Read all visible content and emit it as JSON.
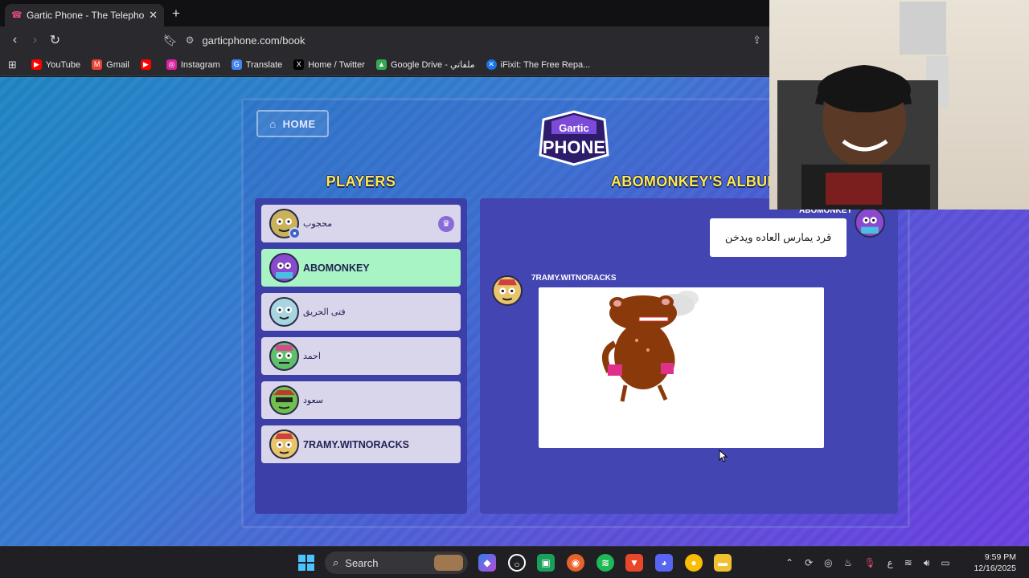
{
  "browser": {
    "tab_title": "Gartic Phone - The Telephone Ga",
    "tab_favicon": "phone-icon",
    "url": "garticphone.com/book",
    "bookmarks": [
      {
        "label": "YouTube",
        "color": "#ff0000"
      },
      {
        "label": "Gmail",
        "color": "#ea4335"
      },
      {
        "label": "",
        "color": "#ff0000"
      },
      {
        "label": "Instagram",
        "color": "#d6249f"
      },
      {
        "label": "Translate",
        "color": "#4285f4"
      },
      {
        "label": "Home / Twitter",
        "color": "#000000"
      },
      {
        "label": "Google Drive - ملفاتي",
        "color": "#34a853"
      },
      {
        "label": "iFixit: The Free Repa...",
        "color": "#1a73e8"
      }
    ]
  },
  "game": {
    "home_label": "HOME",
    "logo_top": "Gartic",
    "logo_bottom": "PHONE",
    "players_title": "PLAYERS",
    "album_title": "ABOMONKEY'S ALBUM",
    "players": [
      {
        "name": "محجوب",
        "active": false,
        "host": true,
        "color": "#c9b25a"
      },
      {
        "name": "ABOMONKEY",
        "active": true,
        "host": false,
        "color": "#8a4ad0"
      },
      {
        "name": "فتى الحريق",
        "active": false,
        "host": false,
        "color": "#a8d6e0"
      },
      {
        "name": "احمد",
        "active": false,
        "host": false,
        "color": "#5fbf6a"
      },
      {
        "name": "سعود",
        "active": false,
        "host": false,
        "color": "#6fc04f"
      },
      {
        "name": "7RAMY.WITNORACKS",
        "active": false,
        "host": false,
        "color": "#e8c46a"
      }
    ],
    "album": {
      "message_author": "ABOMONKEY",
      "message_text": "قرد يمارس العاده ويدخن",
      "drawing_author": "7RAMY.WITNORACKS"
    }
  },
  "taskbar": {
    "search_label": "Search",
    "tray_lang": "ع",
    "time": "9:59 PM",
    "date": "12/16/2025"
  }
}
